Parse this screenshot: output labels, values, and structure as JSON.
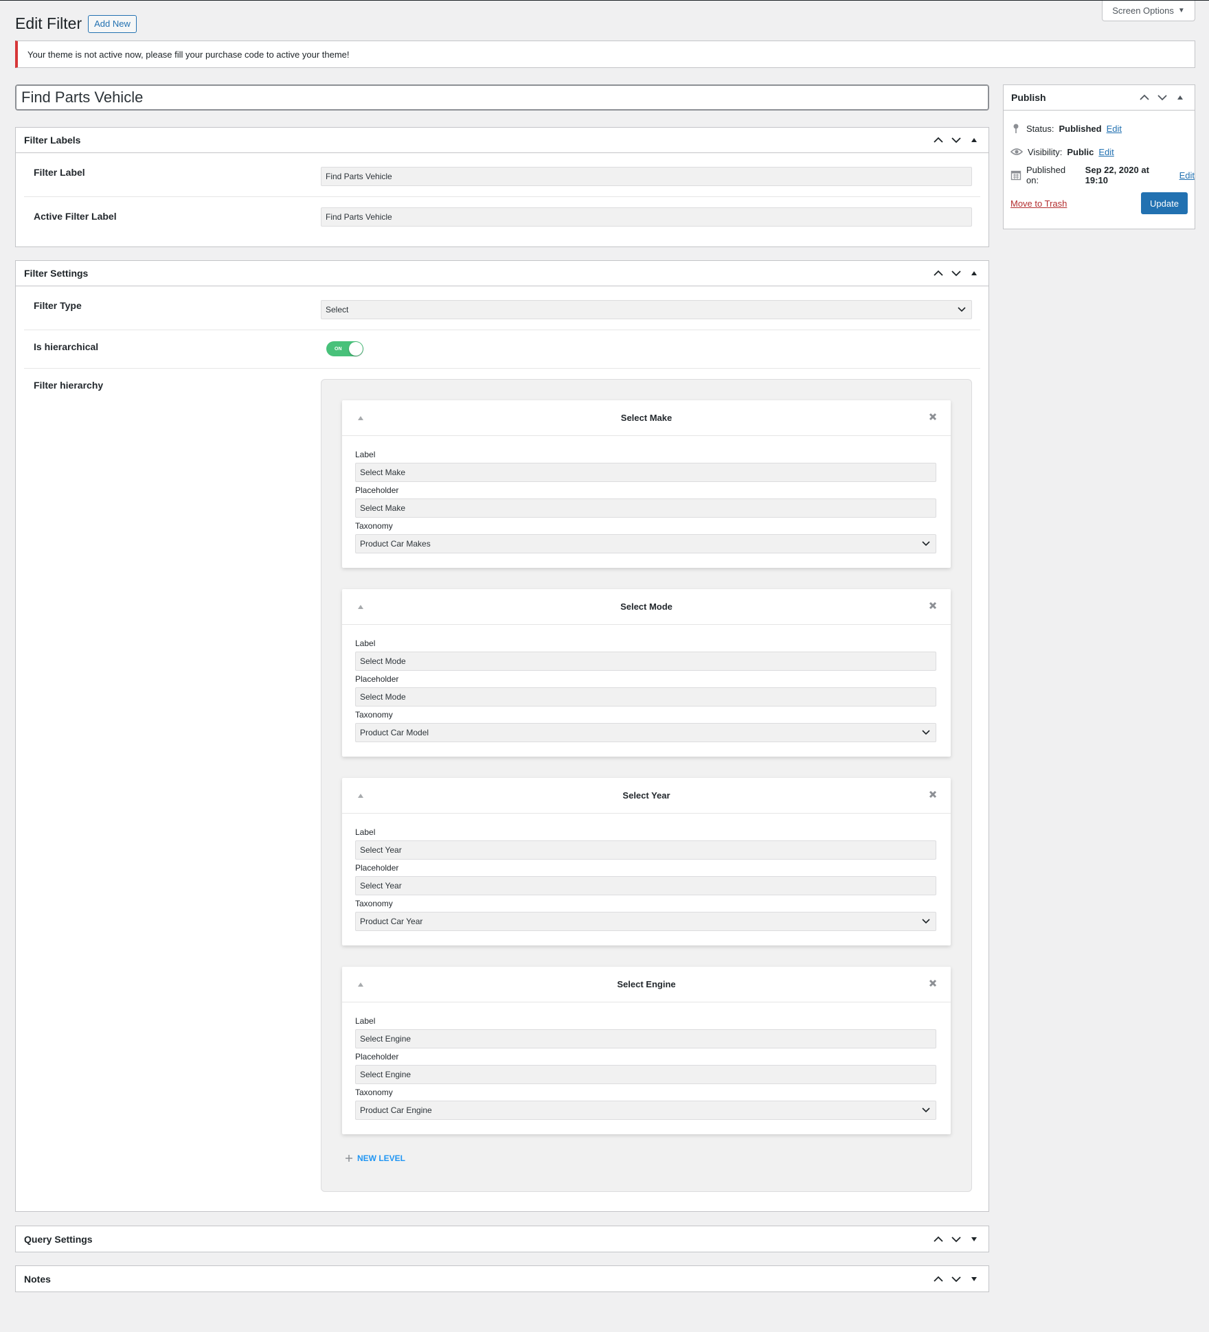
{
  "screen_options": {
    "label": "Screen Options"
  },
  "header": {
    "title": "Edit Filter",
    "add_new": "Add New"
  },
  "notice": {
    "text": "Your theme is not active now, please fill your purchase code to active your theme!"
  },
  "post_title": "Find Parts Vehicle",
  "filter_labels": {
    "title": "Filter Labels",
    "filter_label": {
      "label": "Filter Label",
      "value": "Find Parts Vehicle"
    },
    "active_filter_label": {
      "label": "Active Filter Label",
      "value": "Find Parts Vehicle"
    }
  },
  "filter_settings": {
    "title": "Filter Settings",
    "filter_type": {
      "label": "Filter Type",
      "value": "Select"
    },
    "is_hierarchical": {
      "label": "Is hierarchical",
      "toggle_text": "ON"
    },
    "filter_hierarchy": {
      "label": "Filter hierarchy"
    },
    "field_labels": {
      "label": "Label",
      "placeholder": "Placeholder",
      "taxonomy": "Taxonomy"
    },
    "levels": [
      {
        "title": "Select Make",
        "label": "Select  Make",
        "placeholder": "Select  Make",
        "taxonomy": "Product Car Makes"
      },
      {
        "title": "Select Mode",
        "label": "Select  Mode",
        "placeholder": "Select  Mode",
        "taxonomy": "Product Car Model"
      },
      {
        "title": "Select Year",
        "label": "Select  Year",
        "placeholder": "Select  Year",
        "taxonomy": "Product Car Year"
      },
      {
        "title": "Select Engine",
        "label": "Select  Engine",
        "placeholder": "Select  Engine",
        "taxonomy": "Product Car Engine"
      }
    ],
    "new_level": "NEW LEVEL"
  },
  "query_settings": {
    "title": "Query Settings"
  },
  "notes": {
    "title": "Notes"
  },
  "publish": {
    "title": "Publish",
    "status_label": "Status:",
    "status_value": "Published",
    "visibility_label": "Visibility:",
    "visibility_value": "Public",
    "published_label": "Published on:",
    "published_value": "Sep 22, 2020 at 19:10",
    "edit": "Edit",
    "trash": "Move to Trash",
    "update": "Update"
  },
  "colors": {
    "primary": "#2271b1",
    "error": "#d63638",
    "toggle_on": "#48c17a",
    "new_level": "#2196f3"
  }
}
